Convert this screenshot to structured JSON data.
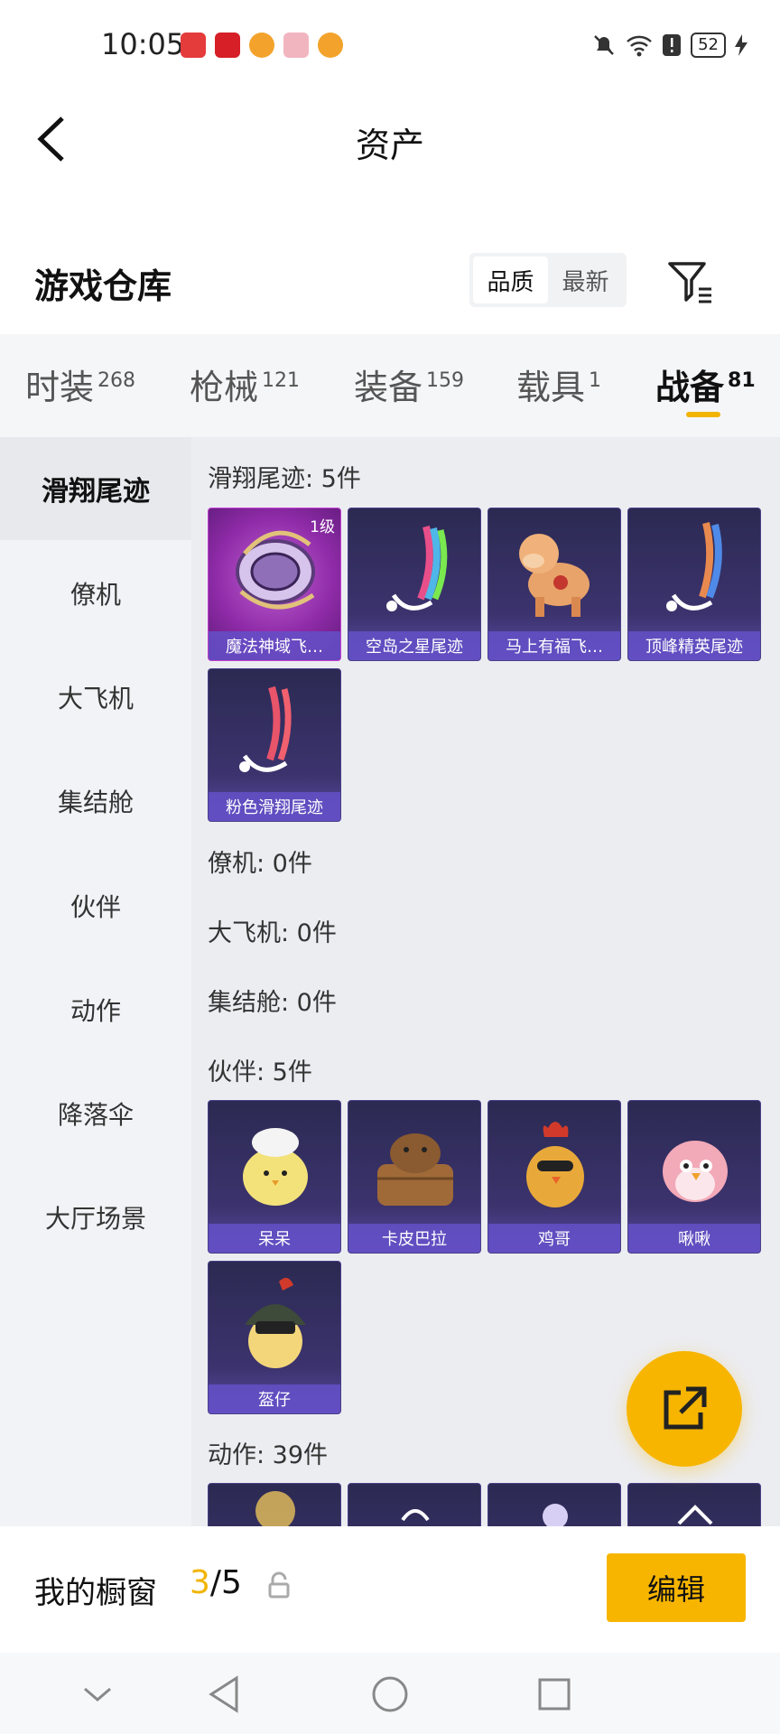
{
  "status_bar": {
    "time": "10:05",
    "battery": "52"
  },
  "nav": {
    "title": "资产"
  },
  "warehouse": {
    "title": "游戏仓库",
    "sort_options": [
      "品质",
      "最新"
    ]
  },
  "category_tabs": [
    {
      "label": "时装",
      "count": "268"
    },
    {
      "label": "枪械",
      "count": "121"
    },
    {
      "label": "装备",
      "count": "159"
    },
    {
      "label": "载具",
      "count": "1"
    },
    {
      "label": "战备",
      "count": "81"
    }
  ],
  "side_menu": [
    "滑翔尾迹",
    "僚机",
    "大飞机",
    "集结舱",
    "伙伴",
    "动作",
    "降落伞",
    "大厅场景"
  ],
  "sections": {
    "glide_trail": {
      "title": "滑翔尾迹: 5件",
      "items": [
        {
          "name": "魔法神域飞…",
          "level": "1级"
        },
        {
          "name": "空岛之星尾迹"
        },
        {
          "name": "马上有福飞…"
        },
        {
          "name": "顶峰精英尾迹"
        },
        {
          "name": "粉色滑翔尾迹"
        }
      ]
    },
    "wingman": {
      "title": "僚机: 0件"
    },
    "big_plane": {
      "title": "大飞机: 0件"
    },
    "capsule": {
      "title": "集结舱: 0件"
    },
    "partner": {
      "title": "伙伴: 5件",
      "items": [
        {
          "name": "呆呆"
        },
        {
          "name": "卡皮巴拉"
        },
        {
          "name": "鸡哥"
        },
        {
          "name": "啾啾"
        },
        {
          "name": "盔仔"
        }
      ]
    },
    "action": {
      "title": "动作: 39件"
    }
  },
  "showcase": {
    "label": "我的橱窗",
    "current": "3",
    "total": "/5",
    "edit_label": "编辑"
  },
  "colors": {
    "accent": "#f7b500",
    "card_bg": "#2b2a52",
    "card_label": "#6450c8"
  }
}
